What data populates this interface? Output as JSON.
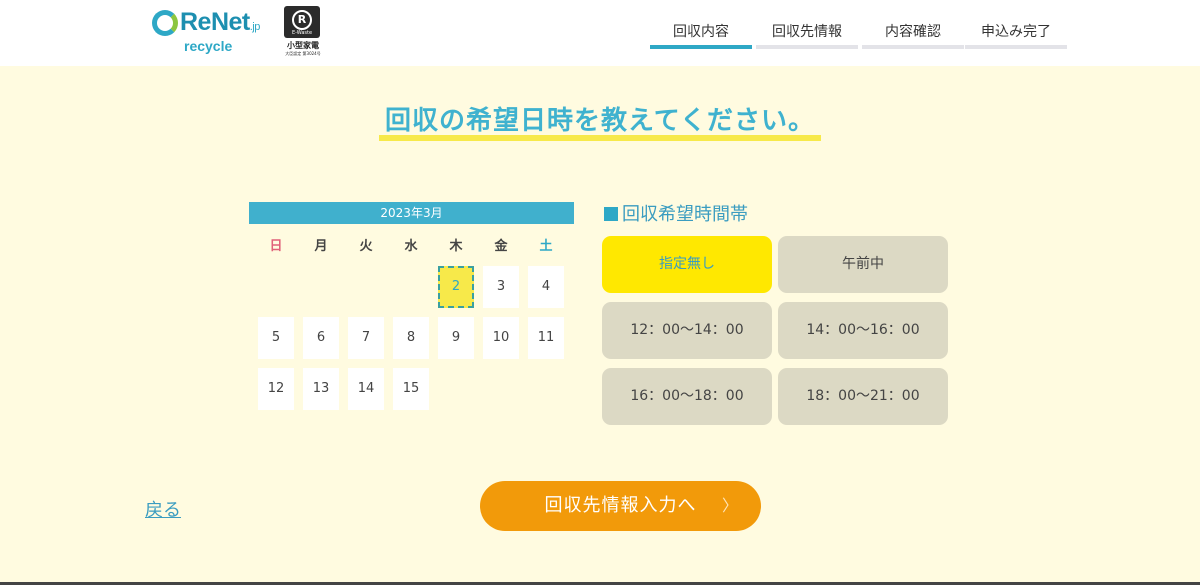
{
  "header": {
    "logo_text": "ReNet",
    "logo_suffix": ".jp",
    "logo_sub": "recycle",
    "cert_mark": "R",
    "cert_mini": "E-Waste",
    "cert_title": "小型家電",
    "cert_number": "大臣認定 第3024号",
    "steps": [
      {
        "label": "回収内容",
        "active": true
      },
      {
        "label": "回収先情報",
        "active": false
      },
      {
        "label": "内容確認",
        "active": false
      },
      {
        "label": "申込み完了",
        "active": false
      }
    ]
  },
  "title": "回収の希望日時を教えてください。",
  "calendar": {
    "month": "2023年3月",
    "weekdays": [
      "日",
      "月",
      "火",
      "水",
      "木",
      "金",
      "土"
    ],
    "days": [
      "2",
      "3",
      "4",
      "5",
      "6",
      "7",
      "8",
      "9",
      "10",
      "11",
      "12",
      "13",
      "14",
      "15"
    ],
    "selected_day": "2"
  },
  "time": {
    "title": "回収希望時間帯",
    "slots": [
      {
        "label": "指定無し",
        "active": true
      },
      {
        "label": "午前中",
        "active": false
      },
      {
        "label": "12：00～14：00",
        "active": false
      },
      {
        "label": "14：00～16：00",
        "active": false
      },
      {
        "label": "16：00～18：00",
        "active": false
      },
      {
        "label": "18：00～21：00",
        "active": false
      }
    ]
  },
  "nav": {
    "back": "戻る",
    "next": "回収先情報入力へ",
    "next_chevron": "〉"
  },
  "colors": {
    "accent": "#2ea8c6",
    "highlight": "#ffe800",
    "button": "#f29a0a",
    "background": "#fffbe0"
  }
}
